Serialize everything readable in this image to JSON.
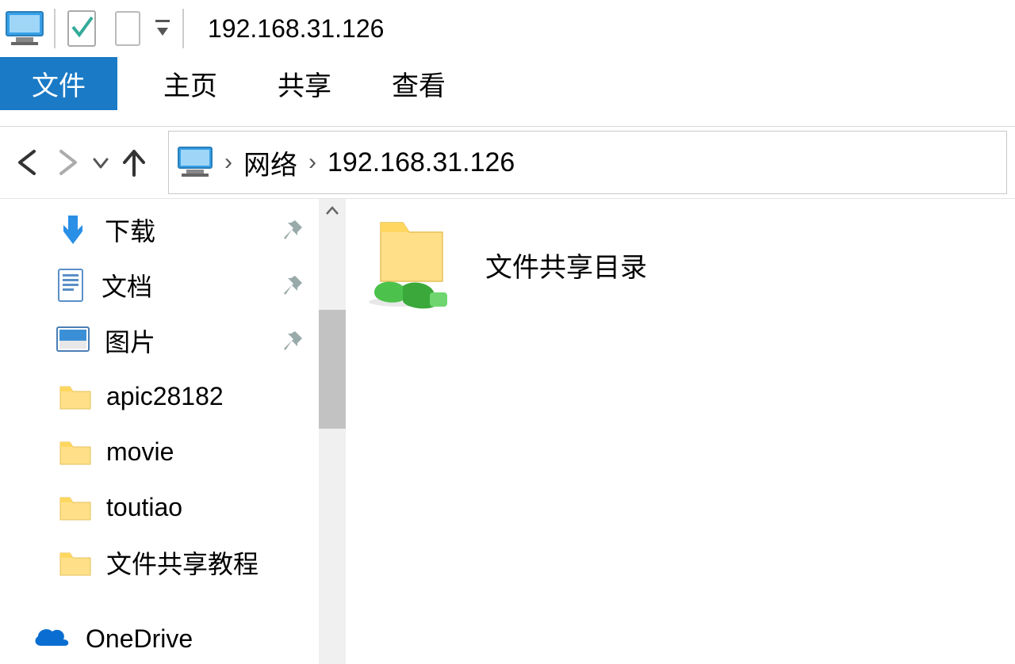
{
  "title": "192.168.31.126",
  "ribbon": {
    "file": "文件",
    "tabs": [
      "主页",
      "共享",
      "查看"
    ]
  },
  "breadcrumb": {
    "root": "网络",
    "current": "192.168.31.126"
  },
  "sidebar": {
    "quick": [
      {
        "label": "下载",
        "icon": "download",
        "pinned": true
      },
      {
        "label": "文档",
        "icon": "document",
        "pinned": true
      },
      {
        "label": "图片",
        "icon": "pictures",
        "pinned": true
      },
      {
        "label": "apic28182",
        "icon": "folder",
        "pinned": false
      },
      {
        "label": "movie",
        "icon": "folder",
        "pinned": false
      },
      {
        "label": "toutiao",
        "icon": "folder",
        "pinned": false
      },
      {
        "label": "文件共享教程",
        "icon": "folder",
        "pinned": false
      }
    ],
    "onedrive": {
      "label": "OneDrive"
    }
  },
  "content": {
    "items": [
      {
        "name": "文件共享目录",
        "type": "shared-folder"
      }
    ]
  }
}
